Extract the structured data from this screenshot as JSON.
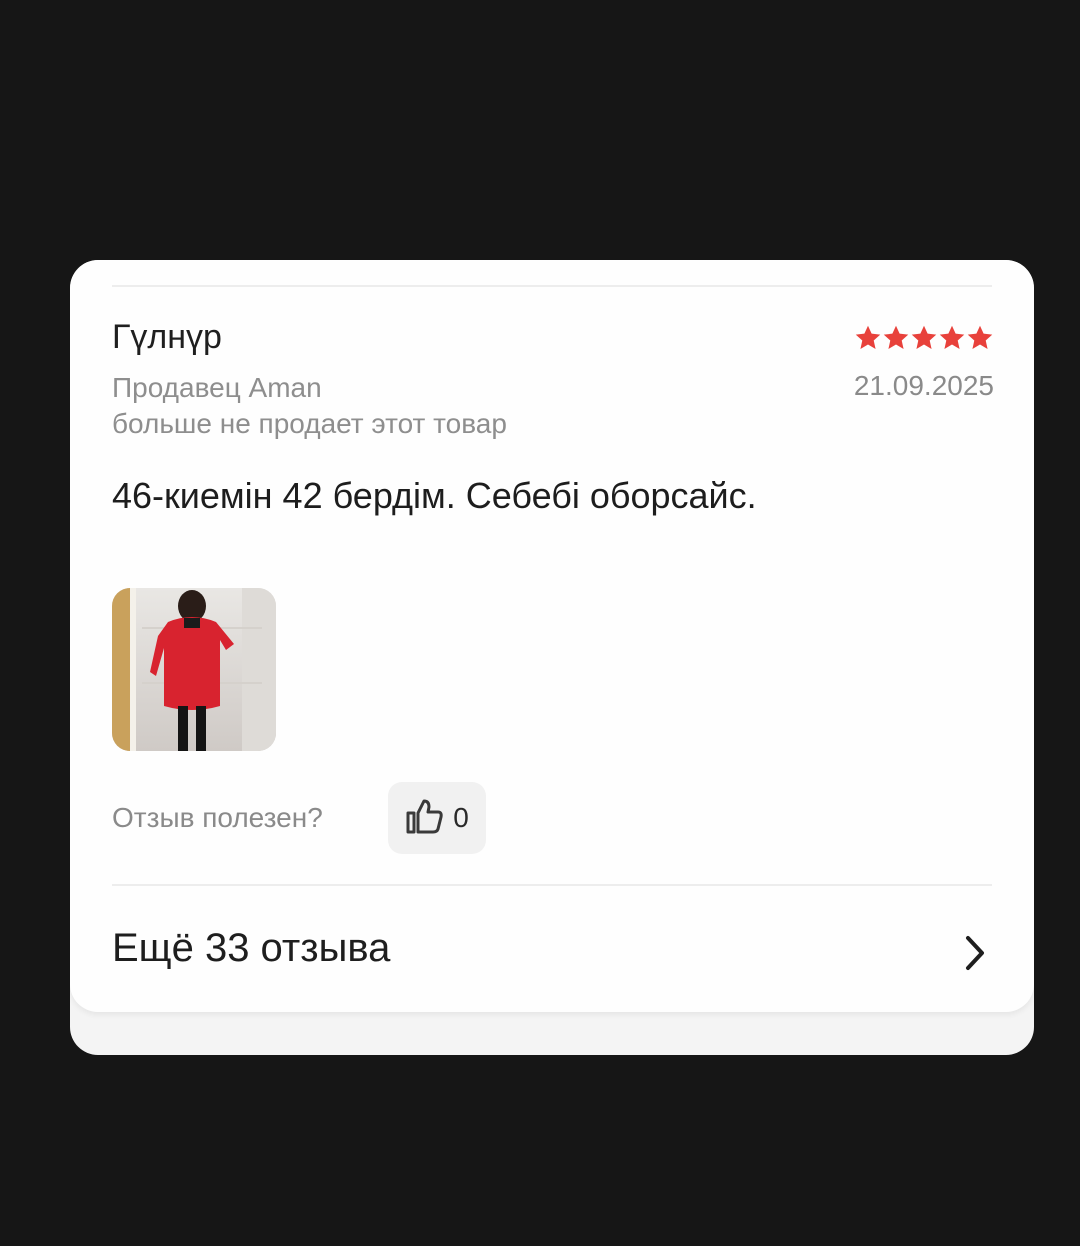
{
  "review": {
    "author": "Гүлнүр",
    "rating": 5,
    "rating_max": 5,
    "star_color": "#e8413b",
    "date": "21.09.2025",
    "seller_line1": "Продавец Aman",
    "seller_line2": "больше не продает этот товар",
    "text": "46-киемін 42 бердім. Себебі оборсайс.",
    "photo_icon": "review-photo-red-coat",
    "helpful_label": "Отзыв полезен?",
    "like_icon": "thumbs-up-icon",
    "like_count": "0"
  },
  "more": {
    "label": "Ещё 33 отзыва",
    "icon": "chevron-right-icon"
  },
  "colors": {
    "background": "#161616",
    "card": "#fefefe",
    "muted_text": "#8a8a8a"
  }
}
